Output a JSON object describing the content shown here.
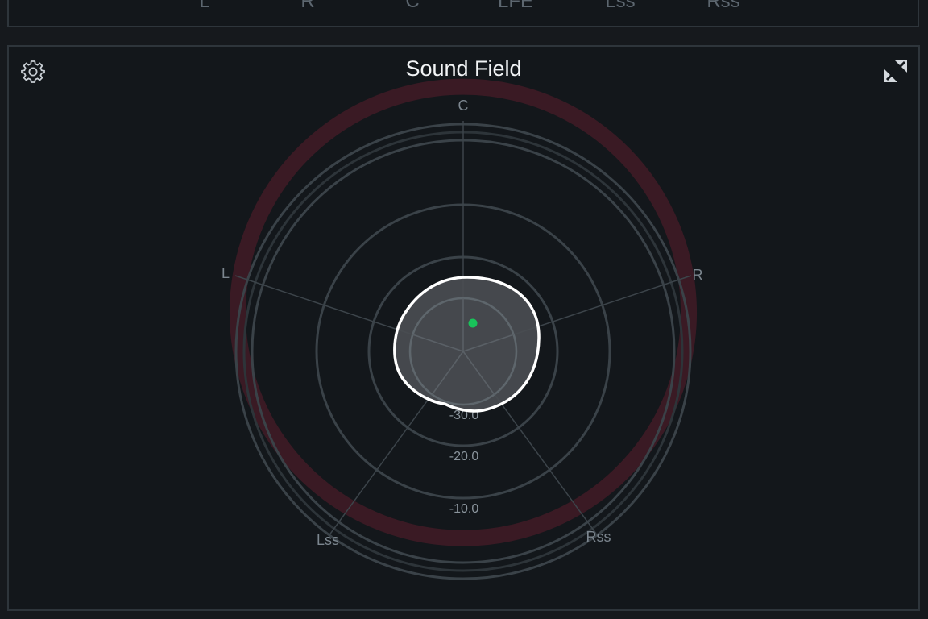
{
  "top_meter": {
    "channels": [
      "L",
      "R",
      "C",
      "LFE",
      "Lss",
      "Rss"
    ]
  },
  "sound_field": {
    "title": "Sound Field",
    "speakers": {
      "c": "C",
      "l": "L",
      "r": "R",
      "lss": "Lss",
      "rss": "Rss"
    },
    "db_scale": {
      "inner": "-30.0",
      "middle": "-20.0",
      "outer": "-10.0"
    },
    "icons": {
      "settings": "gear-icon",
      "expand": "expand-icon"
    },
    "colors": {
      "background": "#13171b",
      "ring": "#3a4248",
      "peak_arc": "#3a1a24",
      "indicator": "#19c35a",
      "blob_fill": "#4a4d51",
      "blob_stroke": "#ffffff"
    }
  }
}
